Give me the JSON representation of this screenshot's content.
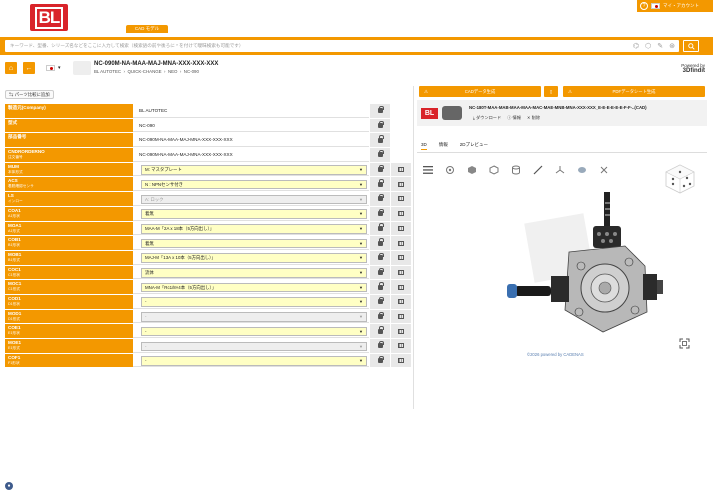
{
  "header": {
    "logo_text": "BL",
    "cad_tab": "CAD モデル",
    "account_label": "マイ・アカウント",
    "help_icon": "question-circle-icon"
  },
  "search": {
    "placeholder": "キーワード、型番、シリーズ名などをここに入力して検索（検索語の前や後ろに * を付けて曖昧検索も可能です）"
  },
  "product": {
    "name": "NC-090M-NA-MAA-MAJ-MNA-XXX-XXX-XXX",
    "breadcrumb": [
      "BL AUTOTEC",
      "QUICK-CHANGE",
      "NEO",
      "NC-090"
    ]
  },
  "powered": {
    "label": "Powered by",
    "brand": "3Dfindit"
  },
  "left": {
    "compare_label": "パーツ比較に追加",
    "rows": [
      {
        "name": "製造元(Company)",
        "sub": "",
        "value": "BL AUTOTEC",
        "kind": "text"
      },
      {
        "name": "型式",
        "sub": "",
        "value": "NC-090",
        "kind": "text"
      },
      {
        "name": "部品番号",
        "sub": "",
        "value": "NC-090M-NA-MAA-MAJ-MNA-XXX-XXX-XXX",
        "kind": "text"
      },
      {
        "name": "CNDRORDERNO",
        "sub": "注文番号",
        "value": "NC-090M-NA-MAA-MAJ-MNA-XXX-XXX-XXX",
        "kind": "text"
      },
      {
        "name": "MUM",
        "sub": "本体形式",
        "value": "M: マスタプレート",
        "kind": "select"
      },
      {
        "name": "ACS",
        "sub": "着脱確認センサ",
        "value": "N : NPNセンサ付き",
        "kind": "select"
      },
      {
        "name": "LS",
        "sub": "インロー",
        "value": "A: ロック",
        "kind": "gray"
      },
      {
        "name": "COA1",
        "sub": "A1形状",
        "value": "着無",
        "kind": "select"
      },
      {
        "name": "MOA1",
        "sub": "A1形式",
        "value": "MAA-M「2A x 18本（5方向出し）」",
        "kind": "select"
      },
      {
        "name": "COB1",
        "sub": "B1形状",
        "value": "着無",
        "kind": "select"
      },
      {
        "name": "MOB1",
        "sub": "B1形式",
        "value": "MAJ-M「13A x 10本（5方向出し）」",
        "kind": "select"
      },
      {
        "name": "COC1",
        "sub": "C1形状",
        "value": "流体",
        "kind": "select"
      },
      {
        "name": "MOC1",
        "sub": "C1形式",
        "value": "MNA-M「Rc1/8×4本（5方向出し）」",
        "kind": "select"
      },
      {
        "name": "COD1",
        "sub": "D1形状",
        "value": "-",
        "kind": "select"
      },
      {
        "name": "MOD1",
        "sub": "D1形式",
        "value": "-",
        "kind": "gray"
      },
      {
        "name": "COE1",
        "sub": "E1形状",
        "value": "-",
        "kind": "select"
      },
      {
        "name": "MOE1",
        "sub": "E1形式",
        "value": "-",
        "kind": "gray"
      },
      {
        "name": "COF1",
        "sub": "F1形状",
        "value": "-",
        "kind": "select"
      }
    ]
  },
  "right": {
    "cad_button": "CADデータ生成",
    "pdf_button": "PDFデータシート生成",
    "cad_name": "NC-180T-MAA-MAB-MAA-MAA-MAC-MAE-MNB-MNA-XXX-XXX_E-E-E-E-E-E-F-F-..(CAD)",
    "download": "ダウンロード",
    "info": "情報",
    "delete": "削除",
    "tabs": [
      "3D",
      "情報",
      "2Dプレビュー"
    ],
    "copyright": "©2026 powered by CADENAS"
  },
  "colors": {
    "accent": "#f39800",
    "brand_red": "#d9242a"
  }
}
